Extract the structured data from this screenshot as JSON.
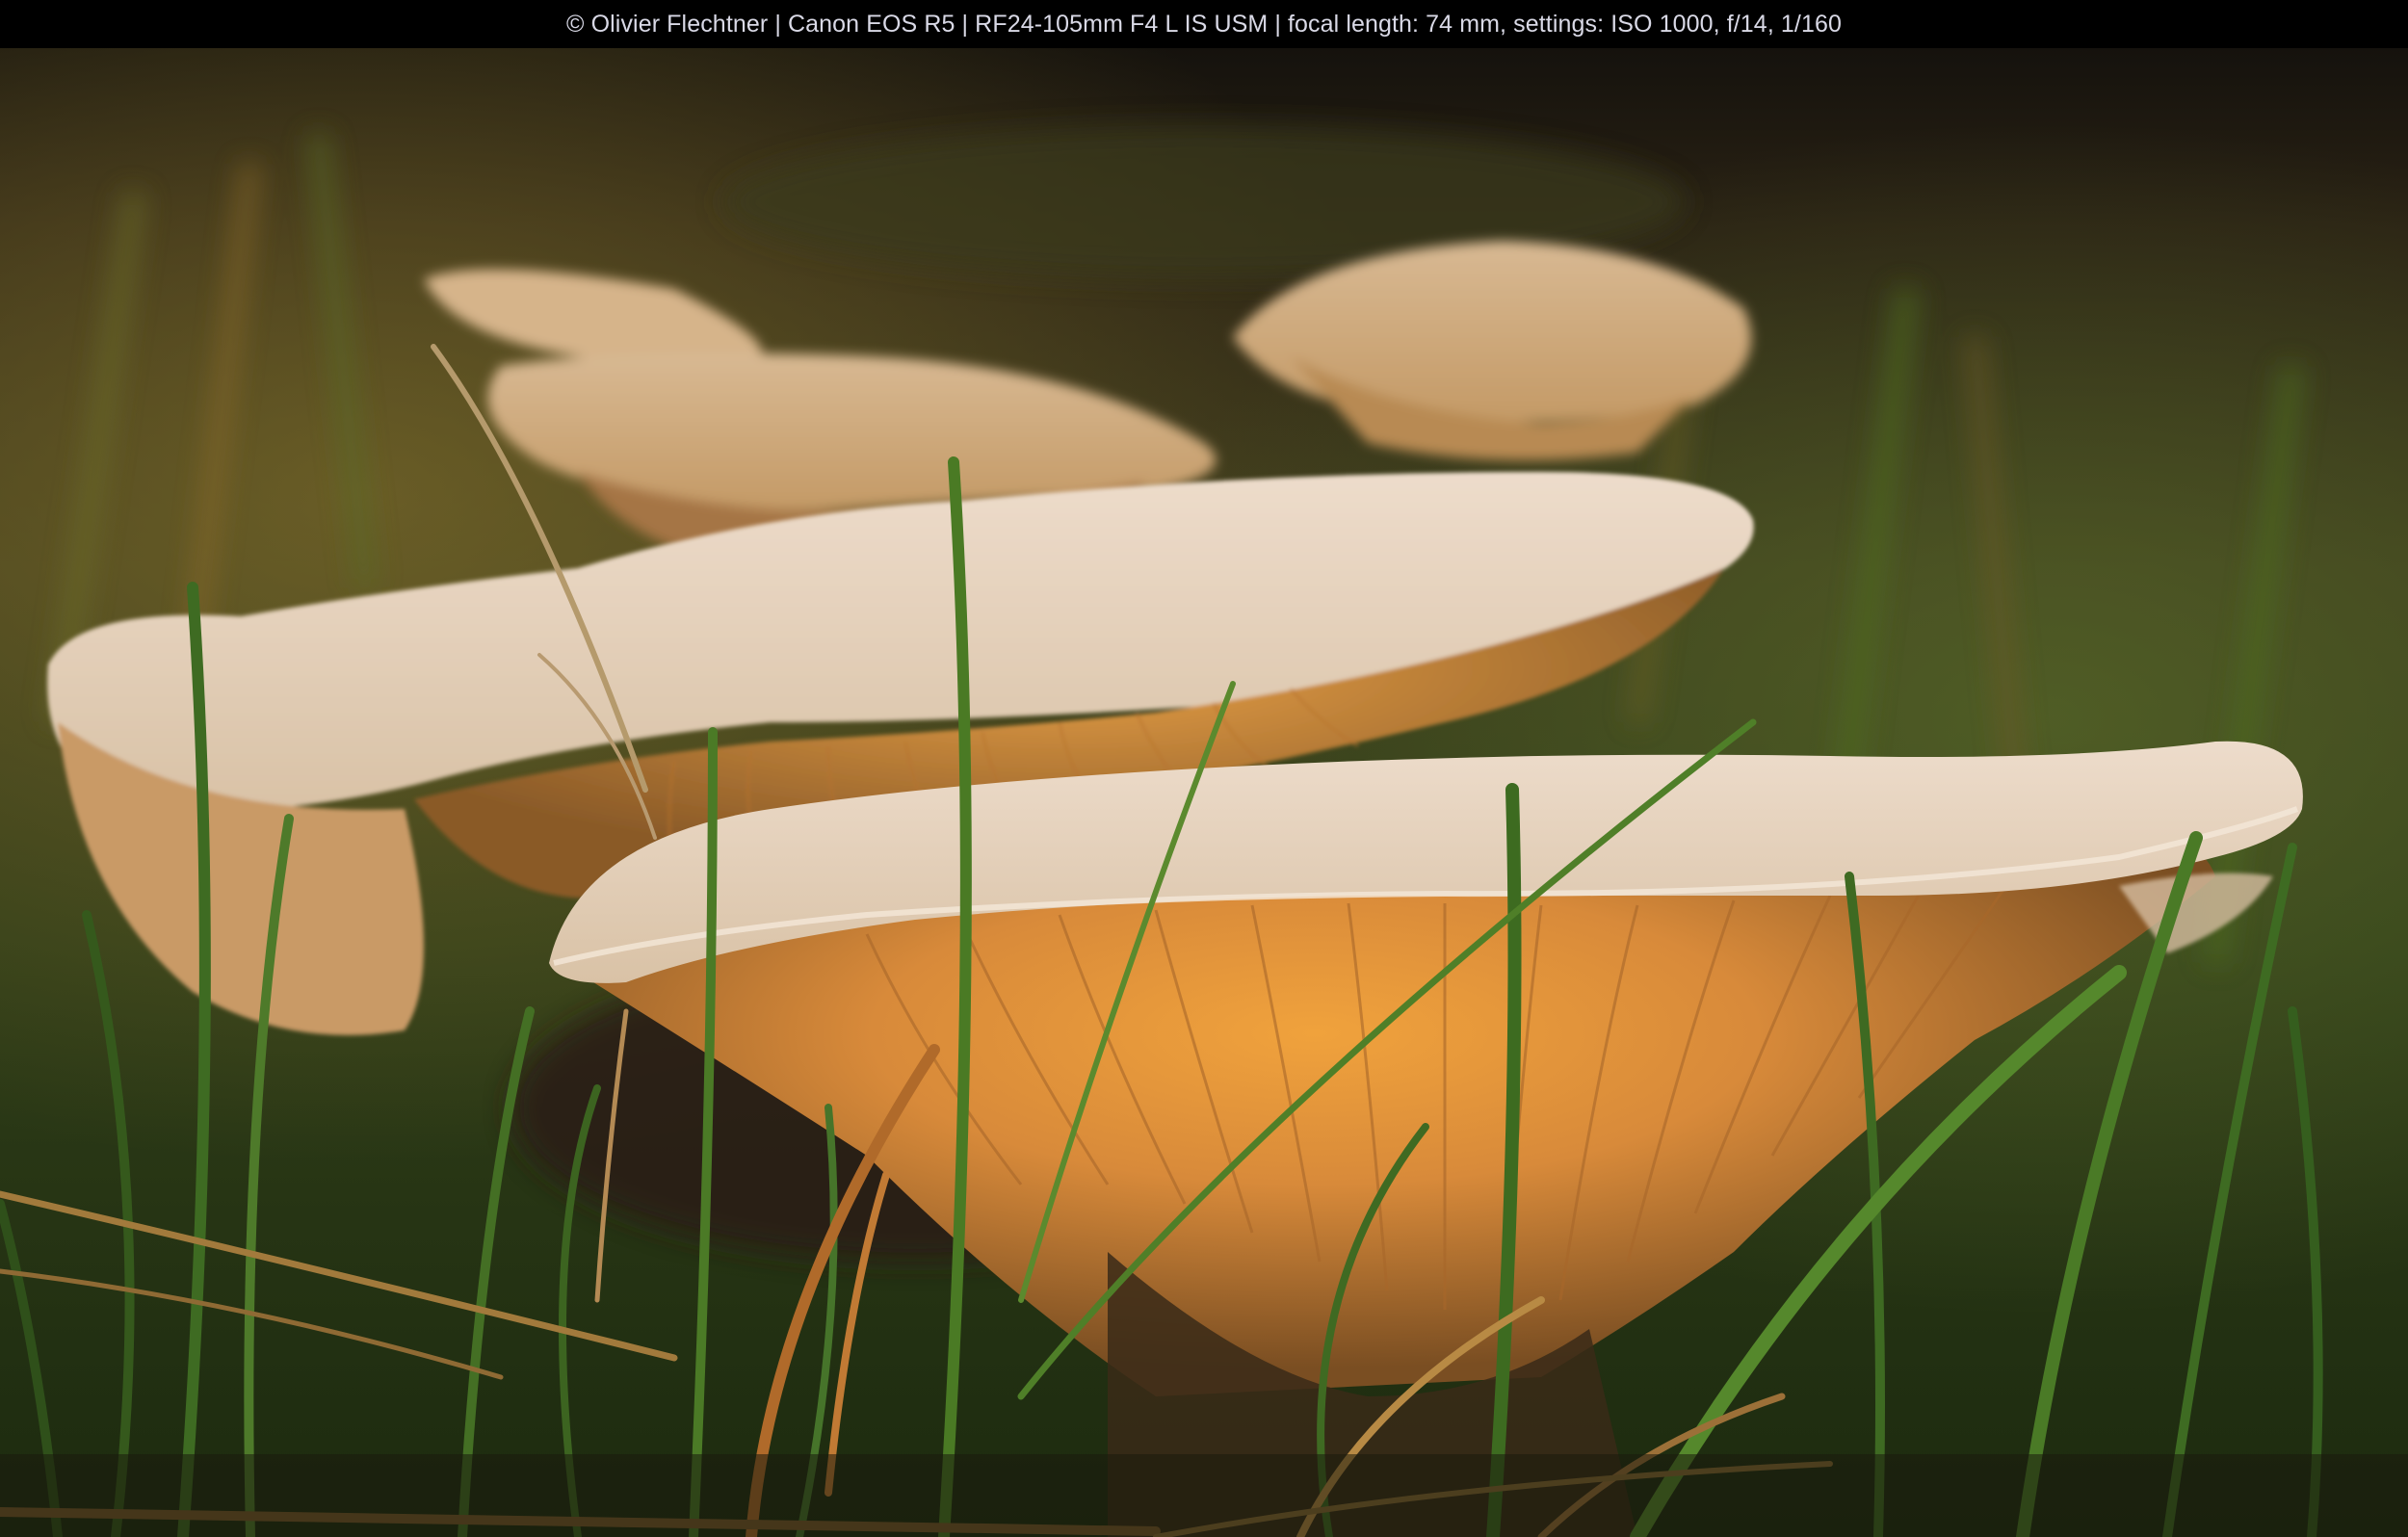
{
  "caption": {
    "text": "© Olivier Flechtner | Canon EOS R5 | RF24-105mm F4 L IS USM | focal length: 74 mm, settings: ISO 1000, f/14, 1/160"
  },
  "photo": {
    "subject": "mushrooms-in-grass",
    "colors": {
      "background_dark": "#1f1a12",
      "grass_green": "#3f6a22",
      "cap_top": "#e8d6c2",
      "gill_orange": "#e08a2a",
      "dry_grass": "#a0743a"
    }
  }
}
